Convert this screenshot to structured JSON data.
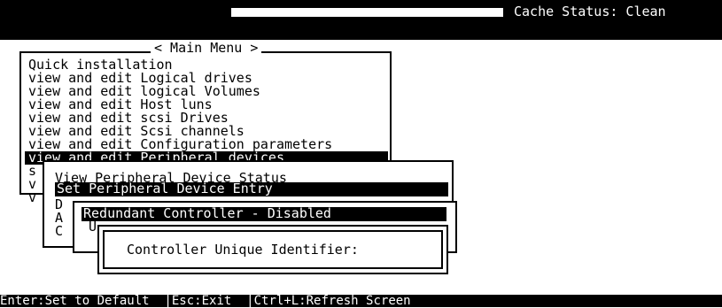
{
  "header": {
    "cache_status": "Cache Status: Clean"
  },
  "main_menu": {
    "title": "< Main Menu >",
    "items": [
      "Quick installation",
      "view and edit Logical drives",
      "view and edit logical Volumes",
      "view and edit Host luns",
      "view and edit scsi Drives",
      "view and edit Scsi channels",
      "view and edit Configuration parameters",
      "view and edit Peripheral devices"
    ],
    "selected_index": 7,
    "partial_items": [
      "s",
      "v",
      "v"
    ]
  },
  "peripheral_menu": {
    "items": [
      "View Peripheral Device Status",
      "Set Peripheral Device Entry"
    ],
    "selected_index": 1,
    "partial_items": [
      "D",
      "A",
      "C"
    ]
  },
  "redundant_menu": {
    "selected_item": "Redundant Controller - Disabled",
    "partial_items": [
      "U"
    ]
  },
  "unique_id_dialog": {
    "label": "Controller Unique Identifier:"
  },
  "status_bar": {
    "set_default": "Enter:Set to Default",
    "exit": "Esc:Exit",
    "refresh": "Ctrl+L:Refresh Screen"
  }
}
